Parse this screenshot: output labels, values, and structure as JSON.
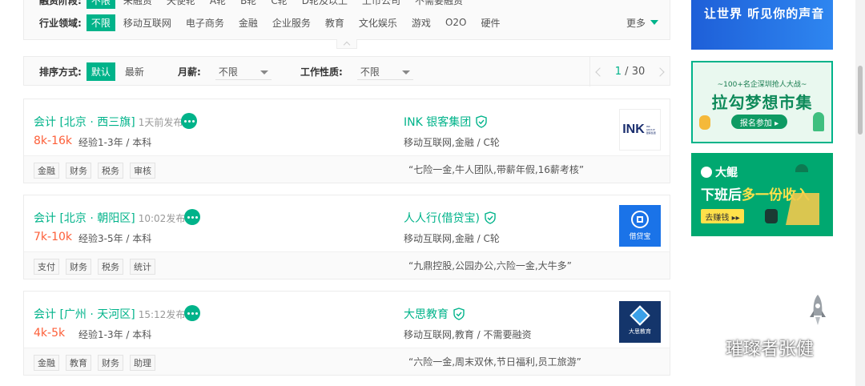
{
  "filters": {
    "financing_row": {
      "label": "融资阶段:",
      "options": [
        "不限",
        "未融资",
        "天使轮",
        "A轮",
        "B轮",
        "C轮",
        "D轮及以上",
        "上市公司",
        "不需要融资"
      ]
    },
    "industry_row": {
      "label": "行业领域:",
      "options": [
        "不限",
        "移动互联网",
        "电子商务",
        "金融",
        "企业服务",
        "教育",
        "文化娱乐",
        "游戏",
        "O2O",
        "硬件"
      ],
      "more": "更多"
    }
  },
  "sort_bar": {
    "sort_label": "排序方式:",
    "sort_default": "默认",
    "sort_latest": "最新",
    "salary_label": "月薪:",
    "salary_value": "不限",
    "nature_label": "工作性质:",
    "nature_value": "不限",
    "page_current": "1",
    "page_separator": "/",
    "page_total": "30"
  },
  "jobs": [
    {
      "title": "会计 [北京 · 西三旗]",
      "time": "1天前发布",
      "salary": "8k-16k",
      "requirements": "经验1-3年 / 本科",
      "company": "INK 银客集团",
      "industry": "移动互联网,金融 / C轮",
      "tags": [
        "金融",
        "财务",
        "税务",
        "审核"
      ],
      "welfare": "“七险一金,牛人团队,带薪年假,16薪考核”",
      "logo_text": "INK",
      "logo_sub": "INK GROUP 银客集团"
    },
    {
      "title": "会计 [北京 · 朝阳区]",
      "time": "10:02发布",
      "salary": "7k-10k",
      "requirements": "经验3-5年 / 本科",
      "company": "人人行(借贷宝)",
      "industry": "移动互联网,金融 / C轮",
      "tags": [
        "支付",
        "财务",
        "税务",
        "统计"
      ],
      "welfare": "“九鼎控股,公园办公,六险一金,大牛多”",
      "logo_text": "借贷宝",
      "logo_sub": ""
    },
    {
      "title": "会计 [广州 · 天河区]",
      "time": "15:12发布",
      "salary": "4k-5k",
      "requirements": "经验1-3年 / 本科",
      "company": "大思教育",
      "industry": "移动互联网,教育 / 不需要融资",
      "tags": [
        "金融",
        "教育",
        "财务",
        "助理"
      ],
      "welfare": "“六险一金,周末双休,节日福利,员工旅游”",
      "logo_text": "大思教育",
      "logo_sub": ""
    }
  ],
  "ads": {
    "ad1_text": "让世界 听见你的声音",
    "ad2_top": "~100+名企深圳抢人大战~",
    "ad2_title": "拉勾梦想市集",
    "ad2_button": "报名参加 ▸",
    "ad3_brand": "大鲲",
    "ad3_text_a": "下班后",
    "ad3_text_b": "多一份收入",
    "ad3_button": "去赚钱 ▸▸"
  },
  "watermark": "璀璨者张健",
  "colors": {
    "accent": "#00b38a",
    "salary": "#fd5f39",
    "ad_blue": "#2e86f0",
    "ad_green": "#00a870"
  }
}
